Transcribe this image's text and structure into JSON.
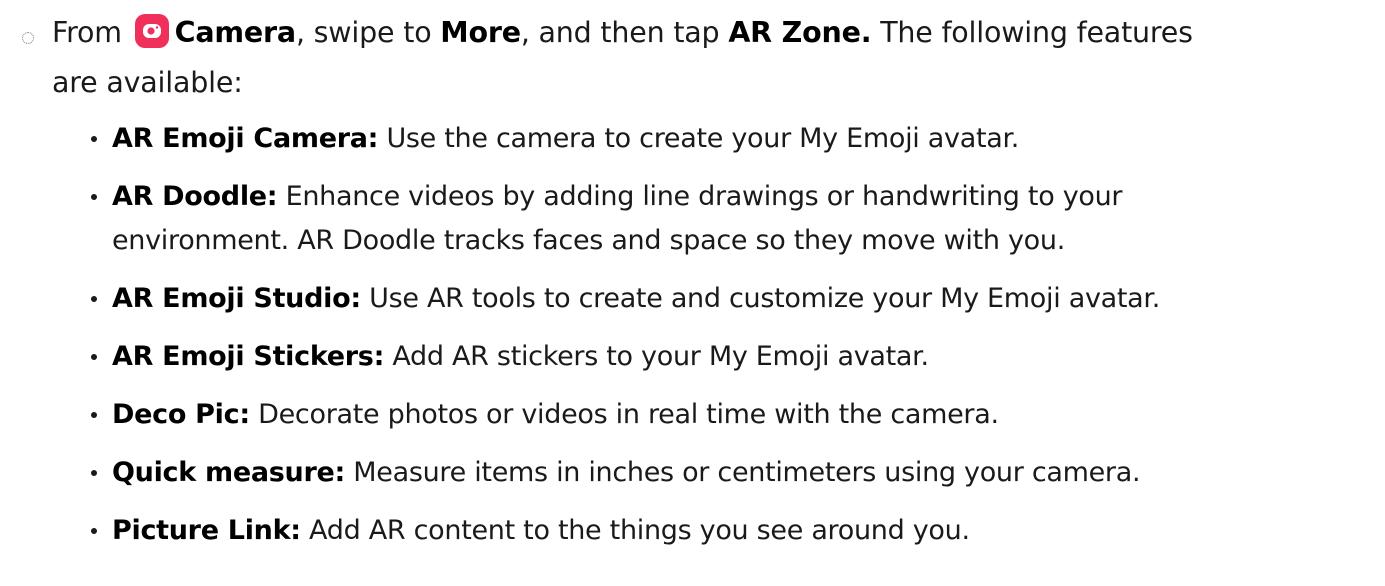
{
  "step": {
    "prefix": "From",
    "app_name": "Camera",
    "middle1": ", swipe to",
    "more": "More",
    "middle2": ", and then tap",
    "zone": "AR Zone.",
    "line1_end": "The following features",
    "line2": "are available:",
    "icon": "camera-app-icon",
    "icon_color": "#f0305a"
  },
  "features": [
    {
      "title": "AR Emoji Camera:",
      "line1": "Use the camera to create your My Emoji avatar.",
      "line2": ""
    },
    {
      "title": "AR Doodle:",
      "line1": "Enhance videos by adding line drawings or handwriting to your",
      "line2": "environment. AR Doodle tracks faces and space so they move with you."
    },
    {
      "title": "AR Emoji Studio:",
      "line1": "Use AR tools to create and customize your My Emoji avatar.",
      "line2": ""
    },
    {
      "title": "AR Emoji Stickers:",
      "line1": "Add AR stickers to your My Emoji avatar.",
      "line2": ""
    },
    {
      "title": "Deco Pic:",
      "line1": "Decorate photos or videos in real time with the camera.",
      "line2": ""
    },
    {
      "title": "Quick measure:",
      "line1": "Measure items in inches or centimeters using your camera.",
      "line2": ""
    },
    {
      "title": "Picture Link:",
      "line1": "Add AR content to the things you see around you.",
      "line2": ""
    }
  ]
}
